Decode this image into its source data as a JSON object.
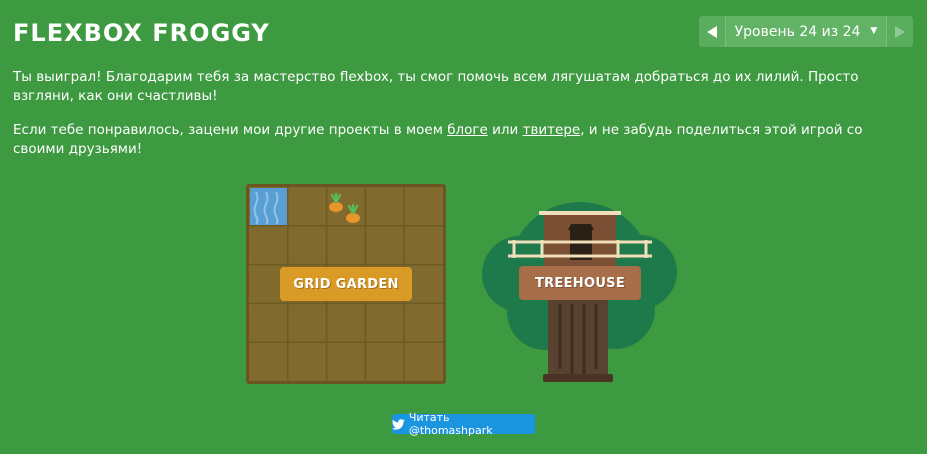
{
  "header": {
    "title": "FLEXBOX FROGGY",
    "level_label": "Уровень 24 из 24",
    "prev_icon": "triangle-left-icon",
    "next_icon": "triangle-right-icon",
    "dropdown_icon": "caret-down-icon"
  },
  "message": {
    "win_text": "Ты выиграл! Благодарим тебя за мастерство flexbox, ты смог помочь всем лягушатам добраться до их лилий. Просто взгляни, как они счастливы!",
    "projects_before": "Если тебе понравилось, зацени мои другие проекты в моем ",
    "blog_link": "блоге",
    "projects_middle": " или ",
    "twitter_link": "твитере",
    "projects_after": ", и не забудь поделиться этой игрой со своими друзьями!"
  },
  "projects": {
    "grid_garden_label": "GRID GARDEN",
    "treehouse_label": "TREEHOUSE"
  },
  "follow": {
    "label": "Читать @thomashpark",
    "icon": "twitter-bird-icon"
  },
  "colors": {
    "background": "#3d9a41",
    "garden_button": "#d99a26",
    "treehouse_button": "#a86e4a",
    "twitter_blue": "#1b95e0",
    "soil": "#7f6a2c",
    "water": "#5a9fd4"
  }
}
